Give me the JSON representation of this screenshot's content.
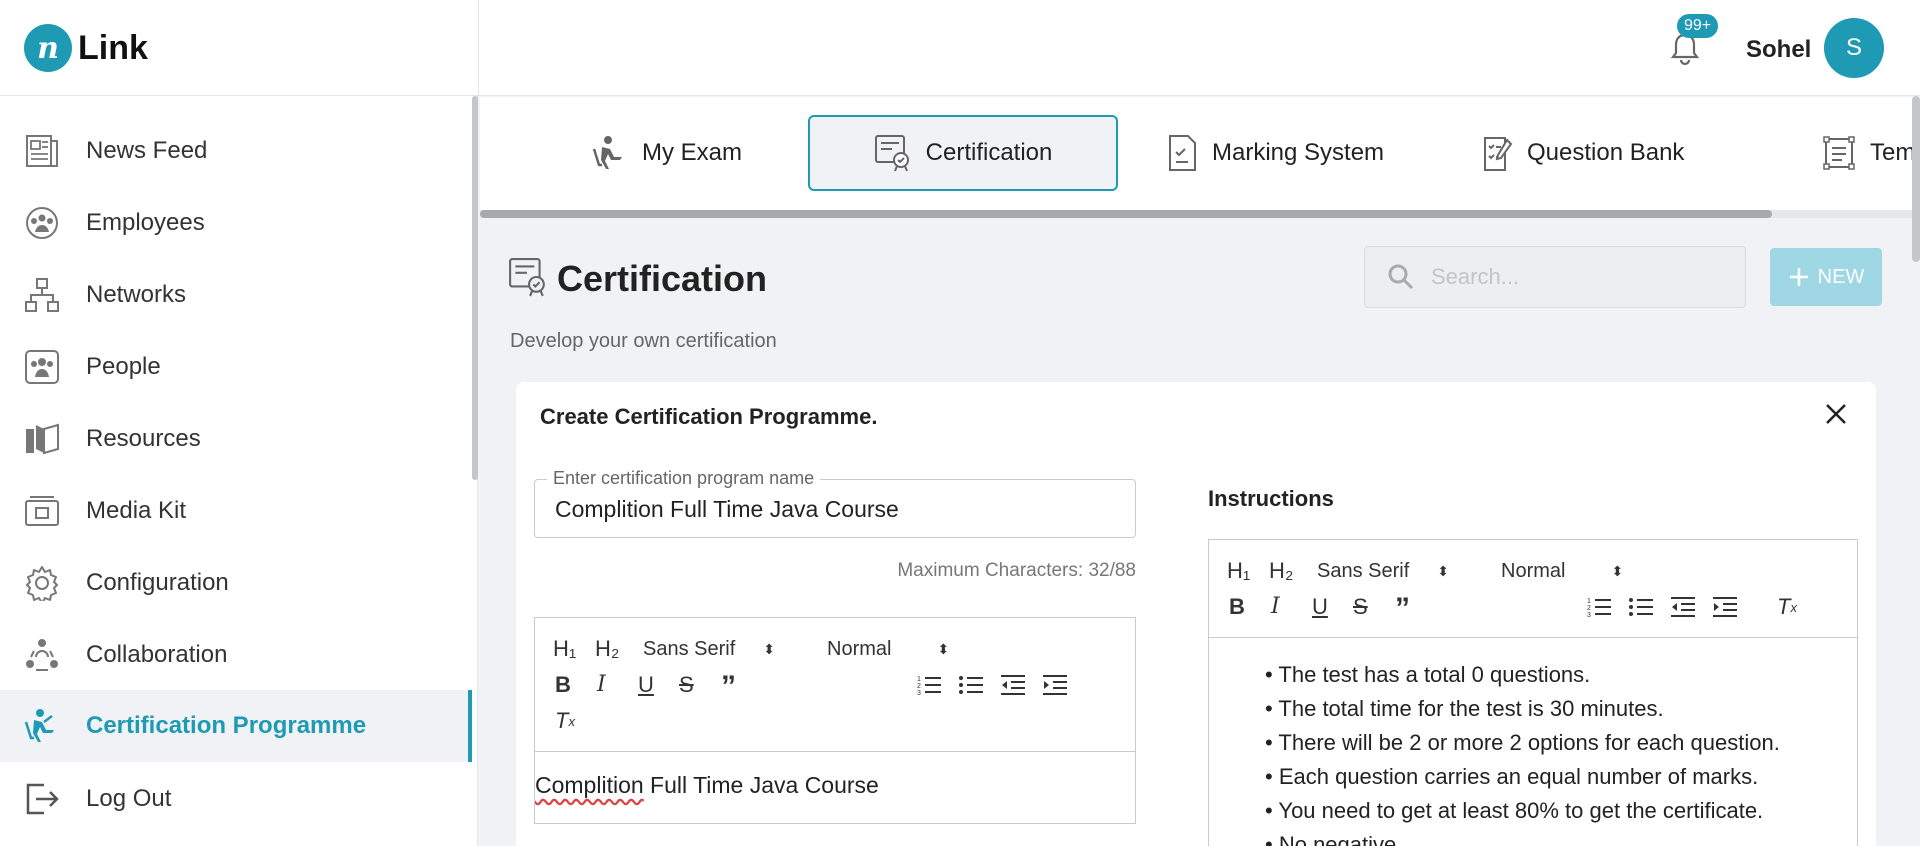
{
  "brand": {
    "mark": "n",
    "name": "Link"
  },
  "header": {
    "notif_count": "99+",
    "user_name": "Sohel",
    "avatar_initial": "S"
  },
  "sidebar": {
    "items": [
      {
        "label": "News Feed",
        "icon": "newspaper-icon"
      },
      {
        "label": "Employees",
        "icon": "employees-icon"
      },
      {
        "label": "Networks",
        "icon": "network-icon"
      },
      {
        "label": "People",
        "icon": "people-icon"
      },
      {
        "label": "Resources",
        "icon": "book-icon"
      },
      {
        "label": "Media Kit",
        "icon": "media-kit-icon"
      },
      {
        "label": "Configuration",
        "icon": "gear-icon"
      },
      {
        "label": "Collaboration",
        "icon": "collaboration-icon"
      },
      {
        "label": "Certification Programme",
        "icon": "exam-person-icon",
        "active": true
      },
      {
        "label": "Log Out",
        "icon": "logout-icon"
      }
    ]
  },
  "tabs": [
    {
      "label": "My Exam",
      "icon": "exam-person-icon"
    },
    {
      "label": "Certification",
      "icon": "certificate-icon",
      "active": true
    },
    {
      "label": "Marking System",
      "icon": "marking-icon"
    },
    {
      "label": "Question Bank",
      "icon": "question-bank-icon"
    },
    {
      "label": "Temp",
      "icon": "template-icon"
    }
  ],
  "page": {
    "title": "Certification",
    "subtitle": "Develop your own certification",
    "search_placeholder": "Search...",
    "new_label": "NEW"
  },
  "card": {
    "title": "Create Certification Programme.",
    "name_field": {
      "label": "Enter certification program name",
      "value": "Complition Full Time Java Course"
    },
    "max_chars": "Maximum Characters: 32/88",
    "editor": {
      "h1": "H₁",
      "h2": "H₂",
      "font": "Sans Serif",
      "size": "Normal",
      "body_word1": "Complition",
      "body_rest": " Full Time Java Course"
    },
    "instructions": {
      "title": "Instructions",
      "items": [
        "The test has a total 0 questions.",
        "The total time for the test is 30 minutes.",
        "There will be 2 or more 2 options for each question.",
        "Each question carries an equal number of marks.",
        "You need to get at least 80% to get the certificate.",
        "No negative"
      ]
    }
  },
  "colors": {
    "accent": "#1e9ab5",
    "new_button": "#9fd8e4"
  }
}
